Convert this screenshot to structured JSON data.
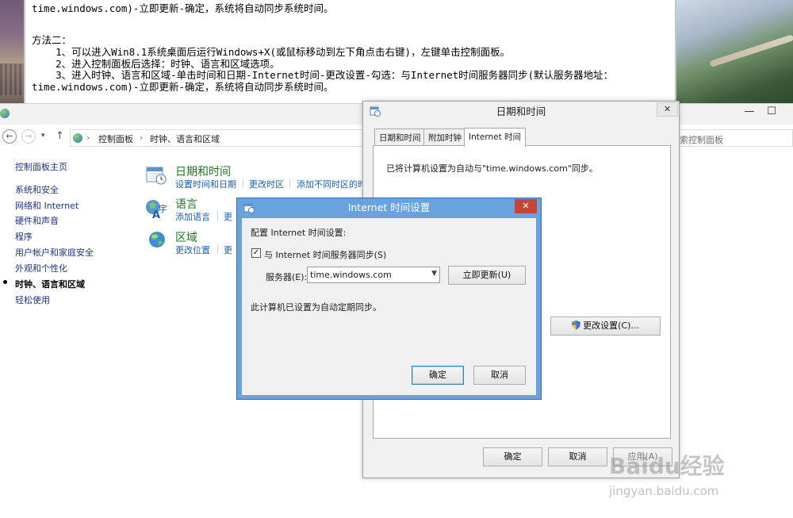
{
  "notepad": {
    "lines": [
      "time.windows.com)-立即更新-确定，系统将自动同步系统时间。",
      "方法二：",
      "    1、可以进入Win8.1系统桌面后运行Windows+X(或鼠标移动到左下角点击右键)，左键单击控制面板。",
      "    2、进入控制面板后选择：时钟、语言和区域选项。",
      "    3、进入时钟、语言和区域-单击时间和日期-Internet时间-更改设置-勾选：与Internet时间服务器同步(默认服务器地址：",
      "time.windows.com)-立即更新-确定，系统将自动同步系统时间。"
    ]
  },
  "control_panel": {
    "breadcrumb": [
      "控制面板",
      "时钟、语言和区域"
    ],
    "search_placeholder": "索控制面板",
    "sidebar": {
      "home": "控制面板主页",
      "items": [
        "系统和安全",
        "网络和 Internet",
        "硬件和声音",
        "程序",
        "用户帐户和家庭安全",
        "外观和个性化",
        "时钟、语言和区域",
        "轻松使用"
      ]
    },
    "categories": [
      {
        "title": "日期和时间",
        "links": [
          "设置时间和日期",
          "更改时区",
          "添加不同时区的时"
        ]
      },
      {
        "title": "语言",
        "links": [
          "添加语言",
          "更"
        ]
      },
      {
        "title": "区域",
        "links": [
          "更改位置",
          "更"
        ]
      }
    ]
  },
  "date_time_dialog": {
    "title": "日期和时间",
    "tabs": [
      "日期和时间",
      "附加时钟",
      "Internet 时间"
    ],
    "status_text": "已将计算机设置为自动与\"time.windows.com\"同步。",
    "change_settings_button": "更改设置(C)...",
    "ok_button": "确定",
    "cancel_button": "取消",
    "apply_button": "应用(A)"
  },
  "internet_time_dialog": {
    "title": "Internet 时间设置",
    "config_label": "配置 Internet 时间设置:",
    "sync_checkbox_label": "与 Internet 时间服务器同步(S)",
    "sync_checked": true,
    "server_label": "服务器(E):",
    "server_value": "time.windows.com",
    "update_now_button": "立即更新(U)",
    "status_text": "此计算机已设置为自动定期同步。",
    "ok_button": "确定",
    "cancel_button": "取消"
  },
  "watermark": {
    "brand": "Baidu经验",
    "url": "jingyan.baidu.com"
  }
}
